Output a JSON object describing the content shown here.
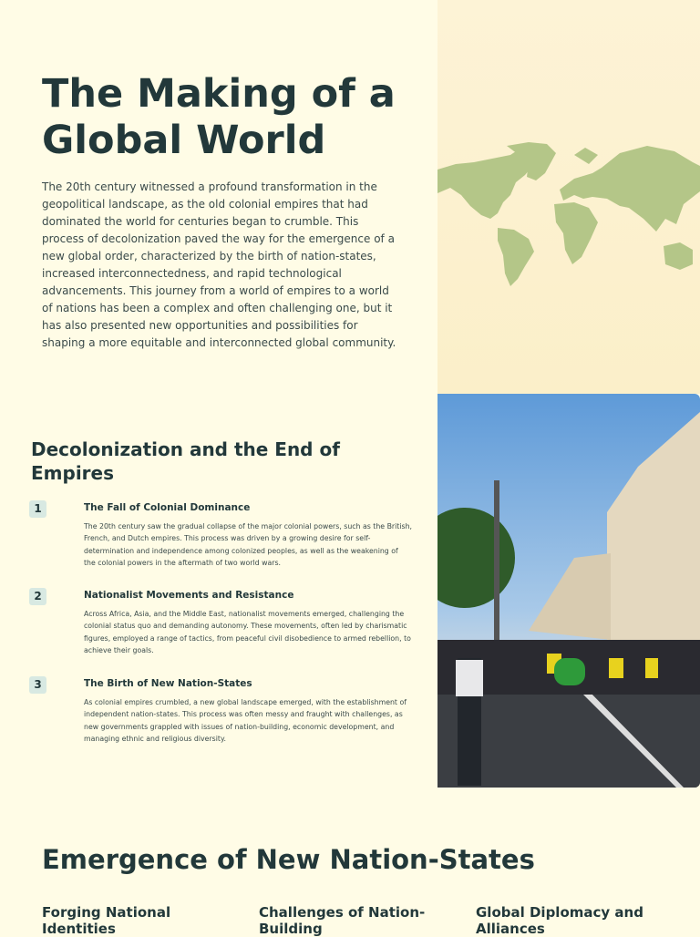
{
  "hero": {
    "title": "The Making of a Global World",
    "text": "The 20th century witnessed a profound transformation in the geopolitical landscape, as the old colonial empires that had dominated the world for centuries began to crumble. This process of decolonization paved the way for the emergence of a new global order, characterized by the birth of nation-states, increased interconnectedness, and rapid technological advancements. This journey from a world of empires to a world of nations has been a complex and often challenging one, but it has also presented new opportunities and possibilities for shaping a more equitable and interconnected global community."
  },
  "decolonization": {
    "title": "Decolonization and the End of Empires",
    "items": [
      {
        "num": "1",
        "title": "The Fall of Colonial Dominance",
        "text": "The 20th century saw the gradual collapse of the major colonial powers, such as the British, French, and Dutch empires. This process was driven by a growing desire for self-determination and independence among colonized peoples, as well as the weakening of the colonial powers in the aftermath of two world wars."
      },
      {
        "num": "2",
        "title": "Nationalist Movements and Resistance",
        "text": "Across Africa, Asia, and the Middle East, nationalist movements emerged, challenging the colonial status quo and demanding autonomy. These movements, often led by charismatic figures, employed a range of tactics, from peaceful civil disobedience to armed rebellion, to achieve their goals."
      },
      {
        "num": "3",
        "title": "The Birth of New Nation-States",
        "text": "As colonial empires crumbled, a new global landscape emerged, with the establishment of independent nation-states. This process was often messy and fraught with challenges, as new governments grappled with issues of nation-building, economic development, and managing ethnic and religious diversity."
      }
    ]
  },
  "emergence": {
    "title": "Emergence of New Nation-States",
    "columns": [
      "Forging National Identities",
      "Challenges of Nation-Building",
      "Global Diplomacy and Alliances"
    ]
  },
  "colors": {
    "background": "#fffce6",
    "text": "#22383a",
    "map_land": "#b4c688",
    "badge": "#d8e9e2"
  }
}
